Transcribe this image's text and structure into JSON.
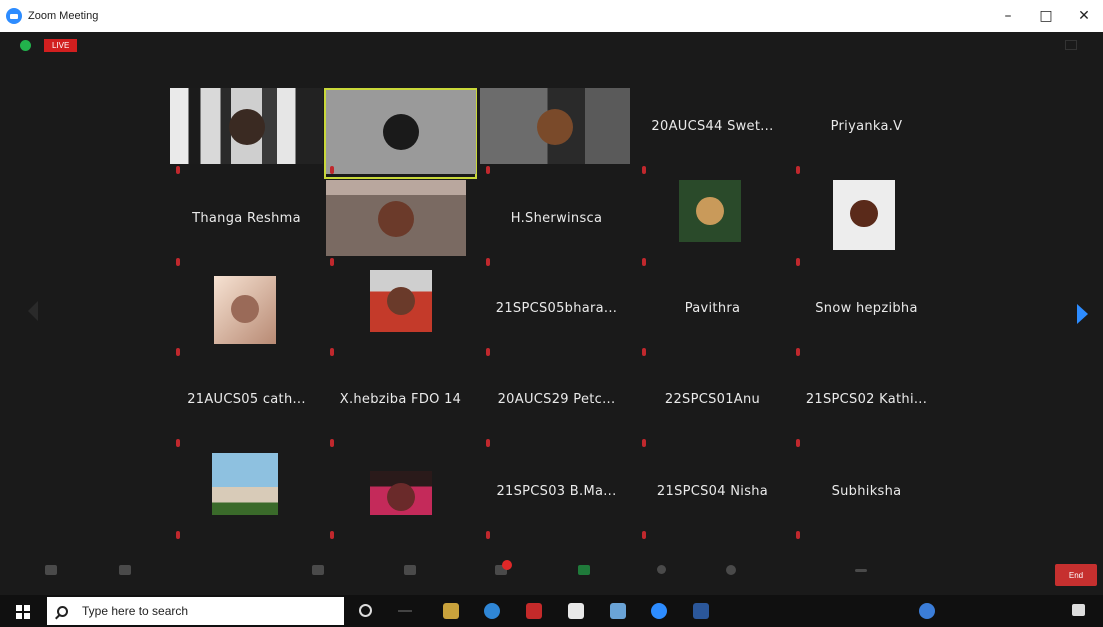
{
  "window": {
    "title": "Zoom Meeting",
    "controls": [
      "–",
      "□",
      "✕"
    ]
  },
  "meeting": {
    "live_label": "LIVE",
    "end_label": "End"
  },
  "taskbar": {
    "search_placeholder": "Type here to search"
  },
  "tiles": [
    {
      "name": "",
      "video": true
    },
    {
      "name": "",
      "video": true,
      "active": true
    },
    {
      "name": "",
      "video": true
    },
    {
      "name": "20AUCS44  Swet..."
    },
    {
      "name": "Priyanka.V"
    },
    {
      "name": "Thanga Reshma"
    },
    {
      "name": "",
      "video": true
    },
    {
      "name": "H.Sherwinsca"
    },
    {
      "name": "",
      "video": true
    },
    {
      "name": "",
      "video": true
    },
    {
      "name": "",
      "video": true
    },
    {
      "name": "",
      "video": true
    },
    {
      "name": "21SPCS05bhara..."
    },
    {
      "name": "Pavithra"
    },
    {
      "name": "Snow hepzibha"
    },
    {
      "name": "21AUCS05  cath..."
    },
    {
      "name": "X.hebziba FDO 14"
    },
    {
      "name": "20AUCS29  Petc..."
    },
    {
      "name": "22SPCS01Anu"
    },
    {
      "name": "21SPCS02  Kathi..."
    },
    {
      "name": "",
      "video": true
    },
    {
      "name": "",
      "video": true
    },
    {
      "name": "21SPCS03  B.Ma..."
    },
    {
      "name": "21SPCS04 Nisha"
    },
    {
      "name": "Subhiksha"
    }
  ],
  "colors": {
    "zoom_blue": "#2d8cff",
    "active_speaker": "#c9d83a",
    "live_red": "#d21f1f",
    "end_red": "#c6302f"
  },
  "icons": {
    "window_logo": "zoom-logo-icon",
    "security": "shield-icon",
    "next_page": "chevron-right-icon",
    "windows_start": "windows-start-icon",
    "search": "search-icon"
  }
}
